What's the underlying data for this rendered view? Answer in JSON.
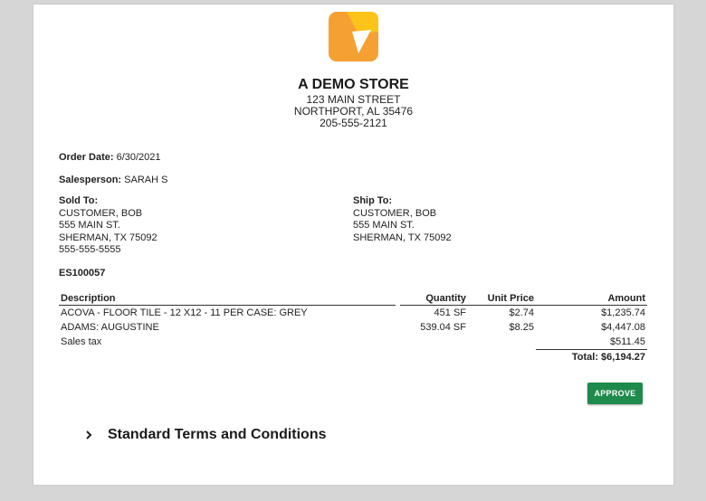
{
  "store": {
    "name": "A DEMO STORE",
    "street": "123 MAIN STREET",
    "city": "NORTHPORT, AL 35476",
    "phone": "205-555-2121"
  },
  "order": {
    "date_label": "Order Date:",
    "date": "6/30/2021",
    "salesperson_label": "Salesperson:",
    "salesperson": "SARAH S",
    "number": "ES100057"
  },
  "sold_to": {
    "label": "Sold To:",
    "lines": [
      "CUSTOMER, BOB",
      "555 MAIN ST.",
      "SHERMAN, TX 75092",
      "555-555-5555"
    ]
  },
  "ship_to": {
    "label": "Ship To:",
    "lines": [
      "CUSTOMER, BOB",
      "555 MAIN ST.",
      "SHERMAN, TX 75092"
    ]
  },
  "table": {
    "headers": {
      "description": "Description",
      "quantity": "Quantity",
      "unit_price": "Unit Price",
      "amount": "Amount"
    },
    "rows": [
      {
        "description": "ACOVA - FLOOR TILE - 12 X12 - 11 PER CASE: GREY",
        "quantity": "451 SF",
        "unit_price": "$2.74",
        "amount": "$1,235.74"
      },
      {
        "description": "ADAMS: AUGUSTINE",
        "quantity": "539.04 SF",
        "unit_price": "$8.25",
        "amount": "$4,447.08"
      }
    ],
    "tax_label": "Sales tax",
    "tax_amount": "$511.45",
    "total": "Total: $6,194.27"
  },
  "approve_label": "APPROVE",
  "terms_title": "Standard Terms and Conditions",
  "colors": {
    "logo_orange": "#f5a033",
    "logo_yellow": "#fcc419",
    "approve_green": "#1e8a4c"
  },
  "icons": {
    "logo": "store-logo-icon",
    "expand": "chevron-right-icon"
  }
}
